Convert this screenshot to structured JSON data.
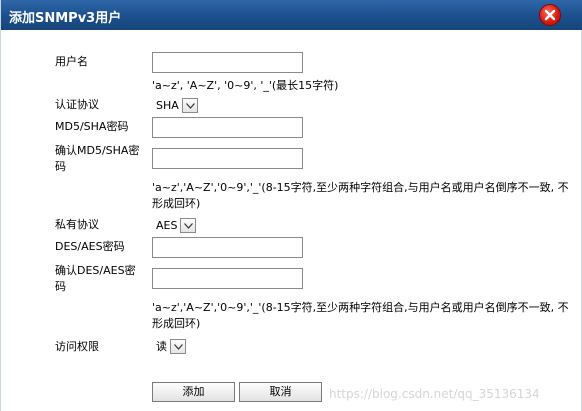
{
  "dialog": {
    "title": "添加SNMPv3用户"
  },
  "form": {
    "username_label": "用户名",
    "username_value": "",
    "username_hint": "'a~z', 'A~Z', '0~9', '_'(最长15字符)",
    "auth_protocol_label": "认证协议",
    "auth_protocol_value": "SHA",
    "auth_password_label": "MD5/SHA密码",
    "auth_password_value": "",
    "confirm_auth_password_label_line1": "确认MD5/SHA密",
    "confirm_auth_password_label_line2": "码",
    "confirm_auth_password_value": "",
    "auth_password_hint_line1": "'a~z','A~Z','0~9','_'(8-15字符,至少两种字符组合,与用户名或用户名倒序不一致, 不",
    "auth_password_hint_line2": "形成回环)",
    "privacy_protocol_label": "私有协议",
    "privacy_protocol_value": "AES",
    "privacy_password_label": "DES/AES密码",
    "privacy_password_value": "",
    "confirm_privacy_password_label_line1": "确认DES/AES密",
    "confirm_privacy_password_label_line2": "码",
    "confirm_privacy_password_value": "",
    "privacy_password_hint_line1": "'a~z','A~Z','0~9','_'(8-15字符,至少两种字符组合,与用户名或用户名倒序不一致, 不",
    "privacy_password_hint_line2": "形成回环)",
    "access_label": "访问权限",
    "access_value": "读"
  },
  "buttons": {
    "add": "添加",
    "cancel": "取消"
  },
  "watermark": "https://blog.csdn.net/qq_35136134",
  "colors": {
    "titlebar": "#1b4f8e",
    "close": "#d81d12"
  }
}
